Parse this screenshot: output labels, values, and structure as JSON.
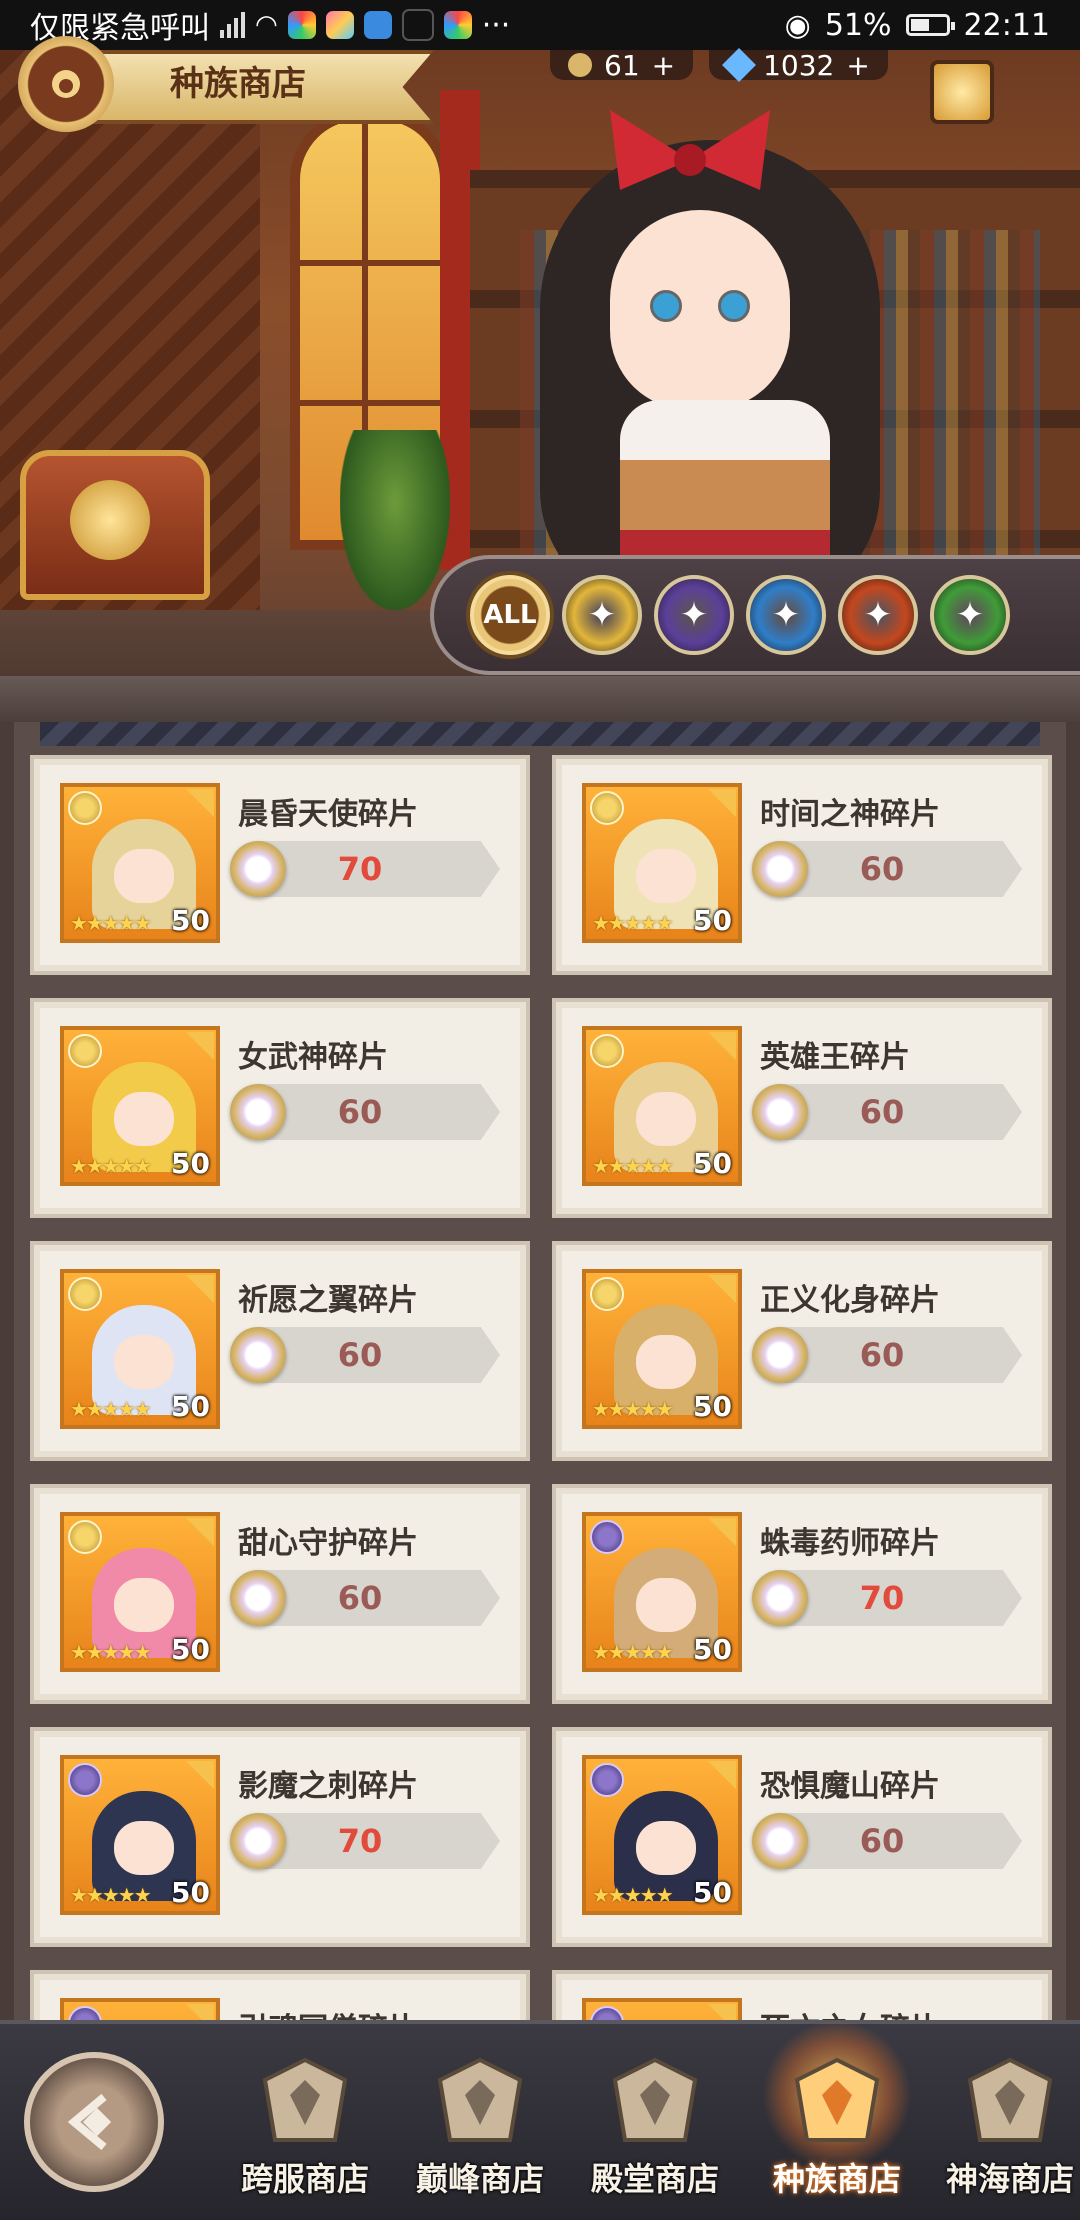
{
  "status_bar": {
    "carrier_text": "仅限紧急呼叫",
    "battery": "51%",
    "time": "22:11",
    "more": "···"
  },
  "header": {
    "shop_title": "种族商店",
    "currency_1": "61",
    "currency_2": "1032",
    "plus": "+"
  },
  "filters": [
    {
      "label": "ALL",
      "icon": "all-filter",
      "color": "#c98a2b"
    },
    {
      "label": "",
      "icon": "light-faction-icon",
      "color": "#e2b63a"
    },
    {
      "label": "",
      "icon": "dark-faction-icon",
      "color": "#5b3f9a"
    },
    {
      "label": "",
      "icon": "human-faction-icon",
      "color": "#2f7ec9"
    },
    {
      "label": "",
      "icon": "orc-faction-icon",
      "color": "#c4471e"
    },
    {
      "label": "",
      "icon": "elf-faction-icon",
      "color": "#3f9c38"
    }
  ],
  "items": [
    {
      "name": "晨昏天使碎片",
      "price": "70",
      "level": "50",
      "price_color": "#e24a3b",
      "faction": "light",
      "hair": "#e6d39a"
    },
    {
      "name": "时间之神碎片",
      "price": "60",
      "level": "50",
      "price_color": "#9a5a55",
      "faction": "light",
      "hair": "#efe3b6"
    },
    {
      "name": "女武神碎片",
      "price": "60",
      "level": "50",
      "price_color": "#9a5a55",
      "faction": "light",
      "hair": "#f2cb4a"
    },
    {
      "name": "英雄王碎片",
      "price": "60",
      "level": "50",
      "price_color": "#9a5a55",
      "faction": "light",
      "hair": "#e9cf92"
    },
    {
      "name": "祈愿之翼碎片",
      "price": "60",
      "level": "50",
      "price_color": "#9a5a55",
      "faction": "light",
      "hair": "#dfe4f4"
    },
    {
      "name": "正义化身碎片",
      "price": "60",
      "level": "50",
      "price_color": "#9a5a55",
      "faction": "light",
      "hair": "#d8b06a"
    },
    {
      "name": "甜心守护碎片",
      "price": "60",
      "level": "50",
      "price_color": "#9a5a55",
      "faction": "light",
      "hair": "#f08aa8"
    },
    {
      "name": "蛛毒药师碎片",
      "price": "70",
      "level": "50",
      "price_color": "#e24a3b",
      "faction": "dark",
      "hair": "#d3ac78"
    },
    {
      "name": "影魔之刺碎片",
      "price": "70",
      "level": "50",
      "price_color": "#e24a3b",
      "faction": "dark",
      "hair": "#2d3550"
    },
    {
      "name": "恐惧魔山碎片",
      "price": "60",
      "level": "50",
      "price_color": "#9a5a55",
      "faction": "dark",
      "hair": "#2b2f4a"
    },
    {
      "name": "引魂冥僧碎片",
      "price": "",
      "level": "",
      "price_color": "#9a5a55",
      "faction": "dark",
      "hair": "#3a3344"
    },
    {
      "name": "死亡之女碎片",
      "price": "",
      "level": "",
      "price_color": "#9a5a55",
      "faction": "dark",
      "hair": "#a3202a"
    }
  ],
  "bottom_nav": [
    {
      "label": "跨服商店",
      "icon": "cross-server-shop-icon",
      "active": false
    },
    {
      "label": "巅峰商店",
      "icon": "peak-shop-icon",
      "active": false
    },
    {
      "label": "殿堂商店",
      "icon": "hall-shop-icon",
      "active": false
    },
    {
      "label": "种族商店",
      "icon": "race-shop-icon",
      "active": true
    },
    {
      "label": "神海商店",
      "icon": "god-sea-shop-icon",
      "active": false
    }
  ]
}
